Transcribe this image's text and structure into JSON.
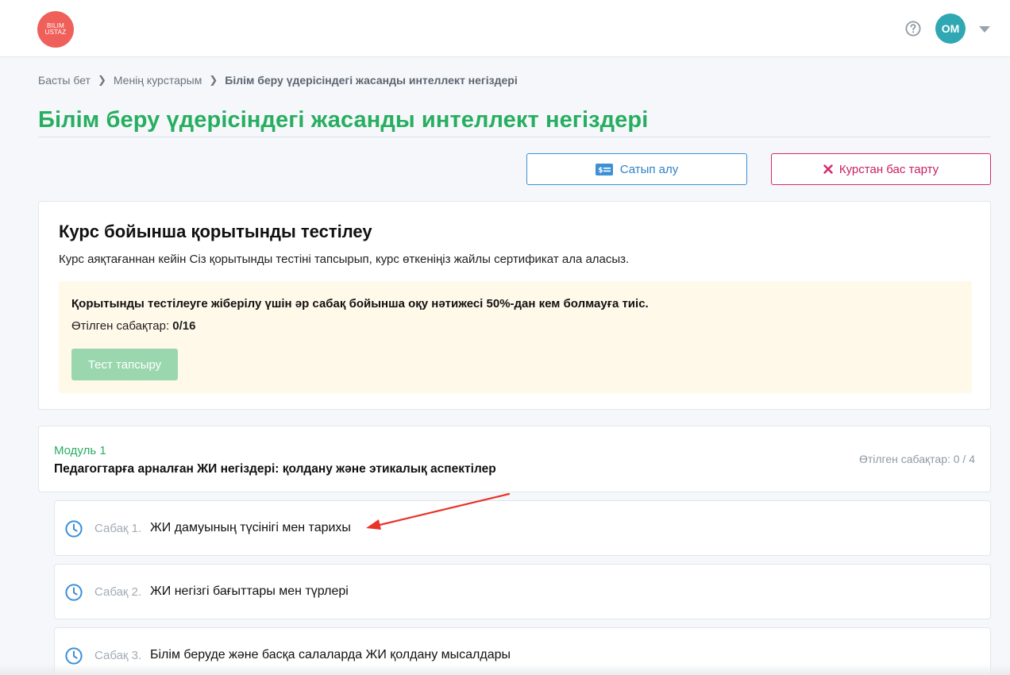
{
  "header": {
    "logo_line1": "BILIM",
    "logo_line2": "USTAZ",
    "avatar_initials": "OM"
  },
  "breadcrumb": {
    "home": "Басты бет",
    "my_courses": "Менің курстарым",
    "current": "Білім беру үдерісіндегі жасанды интеллект негіздері"
  },
  "page_title": "Білім беру үдерісіндегі жасанды интеллект негіздері",
  "actions": {
    "buy_label": "Сатып алу",
    "quit_label": "Курстан бас тарту"
  },
  "final_test": {
    "title": "Курс бойынша қорытынды тестілеу",
    "description": "Курс аяқтағаннан кейін Сіз қорытынды тестіні тапсырып, курс өткеніңіз жайлы сертификат ала аласыз.",
    "requirement": "Қорытынды тестілеуге жіберілу үшін әр сабақ бойынша оқу нәтижесі 50%-дан кем болмауға тиіс.",
    "progress_label": "Өтілген сабақтар:",
    "progress_value": "0/16",
    "button_label": "Тест тапсыру"
  },
  "module": {
    "label": "Модуль 1",
    "name": "Педагогтарға арналған ЖИ негіздері: қолдану және этикалық аспектілер",
    "progress": "Өтілген сабақтар: 0 / 4"
  },
  "lessons": [
    {
      "number": "Сабақ 1.",
      "title": "ЖИ дамуының түсінігі мен тарихы"
    },
    {
      "number": "Сабақ 2.",
      "title": "ЖИ негізгі бағыттары мен түрлері"
    },
    {
      "number": "Сабақ 3.",
      "title": "Білім беруде және басқа салаларда ЖИ қолдану мысалдары"
    }
  ],
  "colors": {
    "accent_green": "#27ae60",
    "link_blue": "#2f7fc8",
    "danger_pink": "#c81e62",
    "annotation_red": "#e8332a"
  }
}
